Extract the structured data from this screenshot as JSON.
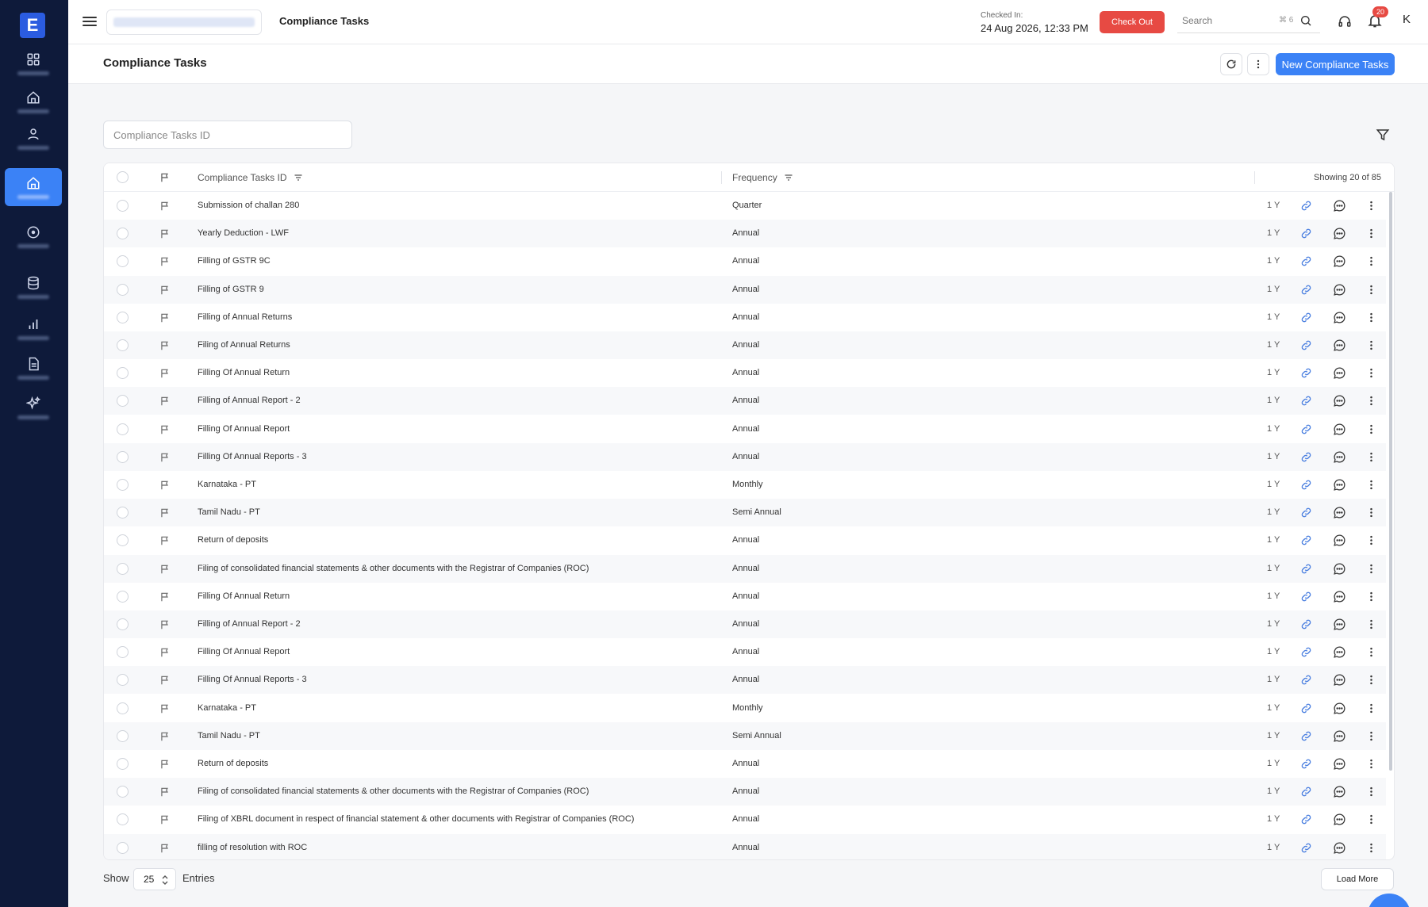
{
  "app": {
    "logo_letter": "E"
  },
  "sidebar": {
    "items": [
      {
        "icon": "grid-icon"
      },
      {
        "icon": "home-icon"
      },
      {
        "icon": "user-icon"
      },
      {
        "icon": "home-icon",
        "active": true
      },
      {
        "icon": "circle-dot-icon"
      },
      {
        "icon": "database-icon"
      },
      {
        "icon": "bar-chart-icon"
      },
      {
        "icon": "document-icon"
      },
      {
        "icon": "sparkle-icon"
      }
    ]
  },
  "topbar": {
    "title": "Compliance Tasks",
    "checked_in_label": "Checked In:",
    "checked_in_value": "24 Aug 2026, 12:33 PM",
    "checkout_label": "Check Out",
    "search_placeholder": "Search",
    "search_shortcut": "⌘ 6",
    "notification_count": "20",
    "avatar_initial": "K"
  },
  "page": {
    "title": "Compliance Tasks",
    "new_button_label": "New Compliance Tasks",
    "id_filter_placeholder": "Compliance Tasks ID"
  },
  "table": {
    "col_id": "Compliance Tasks ID",
    "col_frequency": "Frequency",
    "showing": "Showing 20 of 85",
    "rows": [
      {
        "id": "Submission of challan 280",
        "frequency": "Quarter",
        "period": "1 Y"
      },
      {
        "id": "Yearly Deduction - LWF",
        "frequency": "Annual",
        "period": "1 Y"
      },
      {
        "id": "Filling of GSTR 9C",
        "frequency": "Annual",
        "period": "1 Y"
      },
      {
        "id": "Filling of GSTR 9",
        "frequency": "Annual",
        "period": "1 Y"
      },
      {
        "id": "Filling of Annual Returns",
        "frequency": "Annual",
        "period": "1 Y"
      },
      {
        "id": "Filing of Annual Returns",
        "frequency": "Annual",
        "period": "1 Y"
      },
      {
        "id": "Filling Of Annual Return",
        "frequency": "Annual",
        "period": "1 Y"
      },
      {
        "id": "Filling of Annual Report - 2",
        "frequency": "Annual",
        "period": "1 Y"
      },
      {
        "id": "Filling Of Annual Report",
        "frequency": "Annual",
        "period": "1 Y"
      },
      {
        "id": "Filling Of Annual Reports - 3",
        "frequency": "Annual",
        "period": "1 Y"
      },
      {
        "id": "Karnataka - PT",
        "frequency": "Monthly",
        "period": "1 Y"
      },
      {
        "id": "Tamil Nadu - PT",
        "frequency": "Semi Annual",
        "period": "1 Y"
      },
      {
        "id": "Return of deposits",
        "frequency": "Annual",
        "period": "1 Y"
      },
      {
        "id": "Filing of consolidated financial statements & other documents with the Registrar of Companies (ROC)",
        "frequency": "Annual",
        "period": "1 Y"
      },
      {
        "id": "Filling Of Annual Return",
        "frequency": "Annual",
        "period": "1 Y"
      },
      {
        "id": "Filling of Annual Report - 2",
        "frequency": "Annual",
        "period": "1 Y"
      },
      {
        "id": "Filling Of Annual Report",
        "frequency": "Annual",
        "period": "1 Y"
      },
      {
        "id": "Filling Of Annual Reports - 3",
        "frequency": "Annual",
        "period": "1 Y"
      },
      {
        "id": "Karnataka - PT",
        "frequency": "Monthly",
        "period": "1 Y"
      },
      {
        "id": "Tamil Nadu - PT",
        "frequency": "Semi Annual",
        "period": "1 Y"
      },
      {
        "id": "Return of deposits",
        "frequency": "Annual",
        "period": "1 Y"
      },
      {
        "id": "Filing of consolidated financial statements & other documents with the Registrar of Companies (ROC)",
        "frequency": "Annual",
        "period": "1 Y"
      },
      {
        "id": "Filing of XBRL document in respect of financial statement & other documents with Registrar of Companies (ROC)",
        "frequency": "Annual",
        "period": "1 Y"
      },
      {
        "id": "filling of resolution with ROC",
        "frequency": "Annual",
        "period": "1 Y"
      }
    ]
  },
  "footer": {
    "show_label": "Show",
    "per_page": "25",
    "entries_label": "Entries",
    "load_more_label": "Load More"
  },
  "colors": {
    "sidebar_bg": "#0e1a3a",
    "accent": "#3b82f6",
    "danger": "#e74a43"
  }
}
